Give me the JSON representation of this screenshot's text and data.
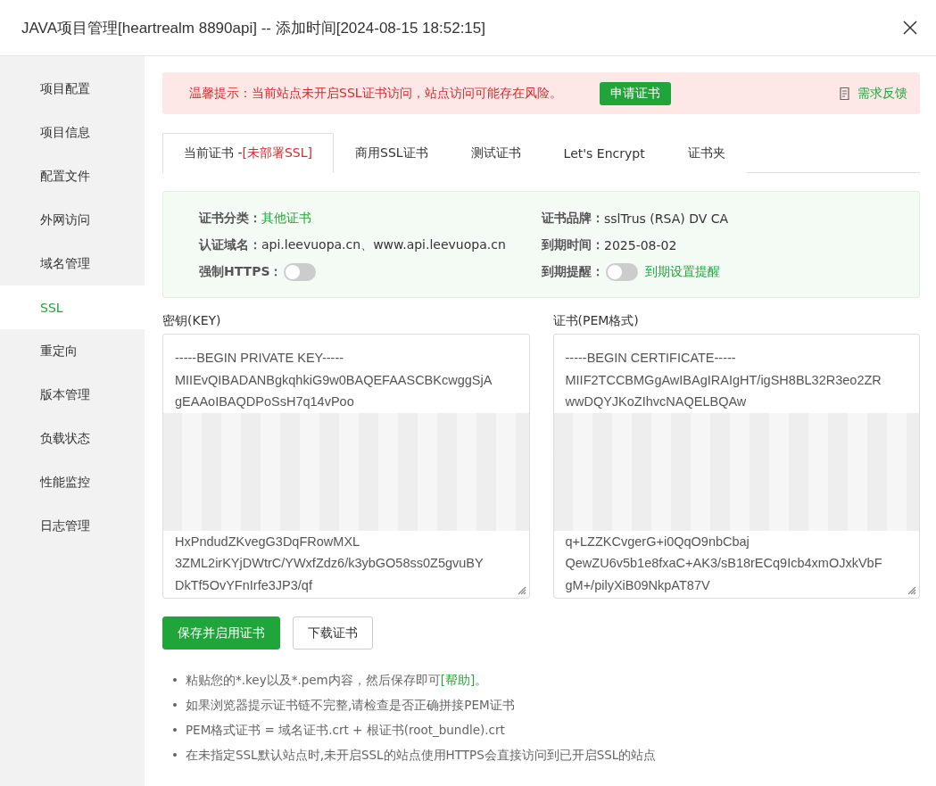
{
  "window": {
    "title": "JAVA项目管理[heartrealm  8890api] -- 添加时间[2024-08-15 18:52:15]"
  },
  "sidebar": {
    "items": [
      {
        "label": "项目配置",
        "selected": false
      },
      {
        "label": "项目信息",
        "selected": false
      },
      {
        "label": "配置文件",
        "selected": false
      },
      {
        "label": "外网访问",
        "selected": false
      },
      {
        "label": "域名管理",
        "selected": false
      },
      {
        "label": "SSL",
        "selected": true
      },
      {
        "label": "重定向",
        "selected": false
      },
      {
        "label": "版本管理",
        "selected": false
      },
      {
        "label": "负载状态",
        "selected": false
      },
      {
        "label": "性能监控",
        "selected": false
      },
      {
        "label": "日志管理",
        "selected": false
      }
    ]
  },
  "alert": {
    "text": "温馨提示：当前站点未开启SSL证书访问，站点访问可能存在风险。",
    "button": "申请证书",
    "feedback": "需求反馈"
  },
  "tabs": [
    {
      "label": "当前证书 -",
      "tag": "[未部署SSL]",
      "selected": true
    },
    {
      "label": "商用SSL证书",
      "selected": false
    },
    {
      "label": "测试证书",
      "selected": false
    },
    {
      "label": "Let's Encrypt",
      "selected": false
    },
    {
      "label": "证书夹",
      "selected": false
    }
  ],
  "info": {
    "category_label": "证书分类：",
    "category": "其他证书",
    "brand_label": "证书品牌：",
    "brand": "sslTrus (RSA) DV CA",
    "domain_label": "认证域名：",
    "domain": "api.leevuopa.cn、www.api.leevuopa.cn",
    "expiry_label": "到期时间：",
    "expiry": "2025-08-02",
    "https_label": "强制HTTPS：",
    "https_on": false,
    "remind_label": "到期提醒：",
    "remind_on": false,
    "remind_link": "到期设置提醒"
  },
  "key": {
    "label": "密钥(KEY)",
    "lines": [
      {
        "kind": "text",
        "text": "-----BEGIN PRIVATE KEY-----"
      },
      {
        "kind": "text",
        "text": "MIIEvQIBADANBgkqhkiG9w0BAQEFAASCBKcwggSjA"
      },
      {
        "kind": "text",
        "text": "gEAAoIBAQDPoSsH7q14vPoo"
      },
      {
        "kind": "redacted"
      },
      {
        "kind": "text",
        "text": "HxPndudZKvegG3DqFRowMXL"
      },
      {
        "kind": "text",
        "text": "3ZML2irKYjDWtrC/YWxfZdz6/k3ybGO58ss0Z5gvuBY"
      },
      {
        "kind": "text",
        "text": "DkTf5OvYFnIrfe3JP3/qf"
      }
    ]
  },
  "cert": {
    "label": "证书(PEM格式)",
    "lines": [
      {
        "kind": "text",
        "text": "-----BEGIN CERTIFICATE-----"
      },
      {
        "kind": "text",
        "text": "MIIF2TCCBMGgAwIBAgIRAIgHT/igSH8BL32R3eo2ZR"
      },
      {
        "kind": "text",
        "text": "wwDQYJKoZIhvcNAQELBQAw"
      },
      {
        "kind": "redacted"
      },
      {
        "kind": "text",
        "text": "q+LZZKCvgerG+i0QqO9nbCbaj"
      },
      {
        "kind": "text",
        "text": "QewZU6v5b1e8fxaC+AK3/sB18rECq9Icb4xmOJxkVbF"
      },
      {
        "kind": "text",
        "text": "gM+/pilyXiB09NkpAT87V"
      }
    ]
  },
  "buttons": [
    {
      "label": "保存并启用证书",
      "kind": "primary"
    },
    {
      "label": "下载证书",
      "kind": "default"
    }
  ],
  "notes": [
    {
      "bullet": "•",
      "text": "粘贴您的*.key以及*.pem内容，然后保存即可",
      "link": "[帮助]",
      "after": "。"
    },
    {
      "bullet": "•",
      "text": "如果浏览器提示证书链不完整,请检查是否正确拼接PEM证书"
    },
    {
      "bullet": "•",
      "text": "PEM格式证书 = 域名证书.crt + 根证书(root_bundle).crt"
    },
    {
      "bullet": "•",
      "text": "在未指定SSL默认站点时,未开启SSL的站点使用HTTPS会直接访问到已开启SSL的站点"
    }
  ]
}
